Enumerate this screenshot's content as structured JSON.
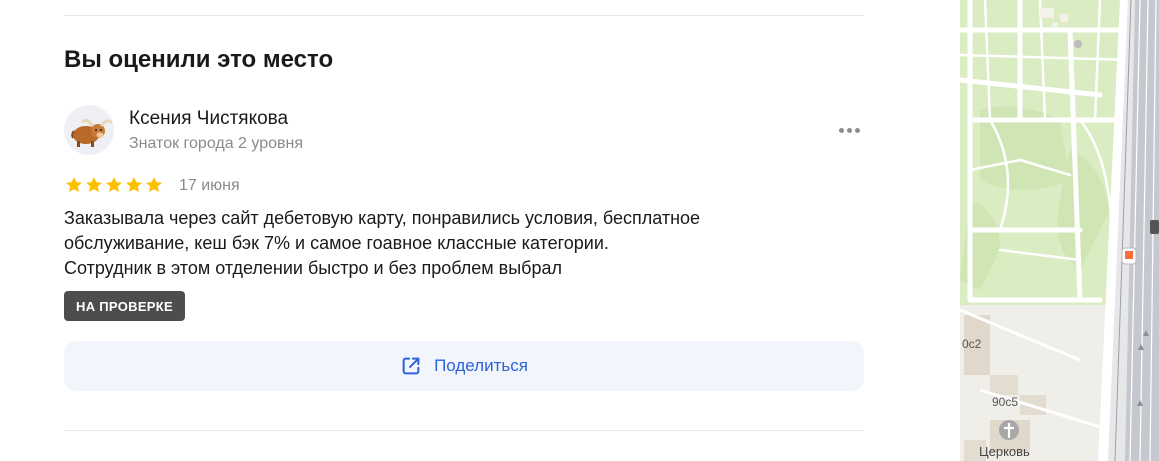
{
  "review_section": {
    "title": "Вы оценили это место",
    "author": {
      "name": "Ксения Чистякова",
      "level": "Знаток города 2 уровня"
    },
    "rating": 5,
    "date": "17 июня",
    "text_lines": [
      "Заказывала через сайт дебетовую карту, понравились условия, бесплатное",
      "обслуживание, кеш бэк 7% и самое гоавное классные категории.",
      "Сотрудник в этом отделении быстро и без проблем выбрал"
    ],
    "status_badge": "НА ПРОВЕРКЕ",
    "share_label": "Поделиться"
  },
  "map": {
    "labels": {
      "building_1": "0с2",
      "building_2": "90с5",
      "church": "Церковь"
    }
  },
  "colors": {
    "accent": "#2c63d9",
    "star": "#fcc200",
    "badge_bg": "#4d4d4d",
    "share_bg": "#f2f5fb",
    "map_green": "#d9ecc2"
  },
  "icons": {
    "avatar": "yak-avatar-icon",
    "more": "more-dots-icon",
    "star": "star-icon",
    "share": "share-external-icon",
    "metro": "metro-icon",
    "church": "church-cross-icon"
  }
}
